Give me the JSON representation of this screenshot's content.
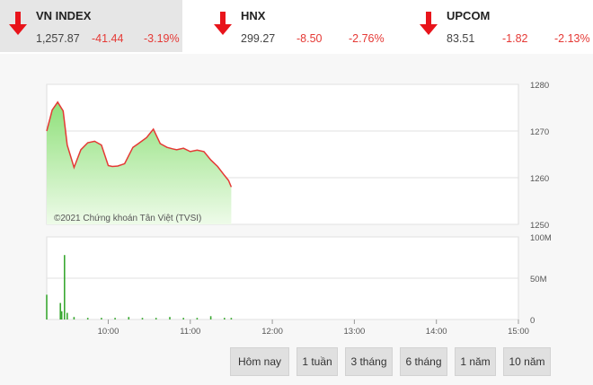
{
  "indices": [
    {
      "name": "VN INDEX",
      "price": "1,257.87",
      "change": "-41.44",
      "percent": "-3.19%",
      "direction": "down",
      "active": true
    },
    {
      "name": "HNX",
      "price": "299.27",
      "change": "-8.50",
      "percent": "-2.76%",
      "direction": "down",
      "active": false
    },
    {
      "name": "UPCOM",
      "price": "83.51",
      "change": "-1.82",
      "percent": "-2.13%",
      "direction": "down",
      "active": false
    }
  ],
  "colors": {
    "down": "#e53935",
    "line": "#e53935",
    "area_top": "#8fe07a",
    "area_bottom": "#eefbe9",
    "volume": "#3aa832"
  },
  "watermark": "©2021 Chứng khoán Tân Việt (TVSI)",
  "range_buttons": [
    "Hôm nay",
    "1 tuần",
    "3 tháng",
    "6 tháng",
    "1 năm",
    "10 năm"
  ],
  "chart_data": [
    {
      "type": "area",
      "y_ticks": [
        "1280",
        "1270",
        "1260",
        "1250"
      ],
      "ylim": [
        1250,
        1280
      ],
      "x_ticks": [
        "10:00",
        "11:00",
        "12:00",
        "13:00",
        "14:00",
        "15:00"
      ],
      "xlim": [
        "9:15",
        "15:00"
      ],
      "series": [
        {
          "x": [
            "9:15",
            "9:19",
            "9:23",
            "9:27",
            "9:30",
            "9:35",
            "9:40",
            "9:45",
            "9:50",
            "9:55",
            "10:00",
            "10:03",
            "10:07",
            "10:12",
            "10:18",
            "10:22",
            "10:28",
            "10:33",
            "10:38",
            "10:43",
            "10:47",
            "10:50",
            "10:55",
            "11:00",
            "11:05",
            "11:10",
            "11:15",
            "11:20",
            "11:25",
            "11:28",
            "11:30"
          ],
          "y": [
            1270,
            1274.5,
            1276.2,
            1274.3,
            1267,
            1262.2,
            1266,
            1267.5,
            1267.8,
            1267,
            1262.6,
            1262.4,
            1262.5,
            1263,
            1266.5,
            1267.3,
            1268.6,
            1270.4,
            1267.3,
            1266.5,
            1266.2,
            1266,
            1266.3,
            1265.6,
            1265.9,
            1265.6,
            1263.8,
            1262.4,
            1260.5,
            1259.4,
            1258
          ]
        }
      ]
    },
    {
      "type": "bar",
      "y_ticks": [
        "100M",
        "50M",
        "0"
      ],
      "ylim": [
        0,
        100
      ],
      "x_ticks": [
        "10:00",
        "11:00",
        "12:00",
        "13:00",
        "14:00",
        "15:00"
      ],
      "series": [
        {
          "x": [
            "9:15",
            "9:25",
            "9:26",
            "9:28",
            "9:30",
            "9:35",
            "9:45",
            "9:55",
            "10:05",
            "10:15",
            "10:25",
            "10:35",
            "10:45",
            "10:55",
            "11:05",
            "11:15",
            "11:25",
            "11:30"
          ],
          "y": [
            30,
            20,
            10,
            78,
            8,
            3,
            2,
            2,
            2,
            3,
            2,
            2,
            3,
            2,
            2,
            4,
            2,
            2
          ]
        }
      ]
    }
  ]
}
